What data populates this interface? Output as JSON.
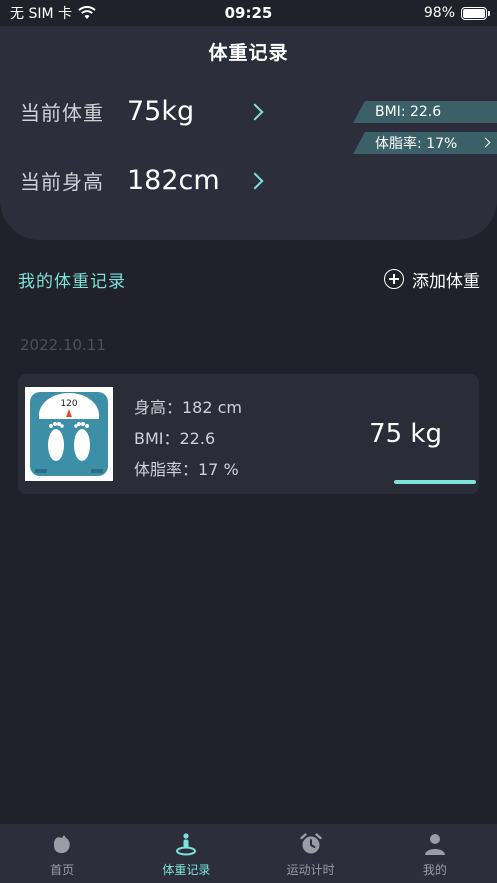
{
  "status_bar": {
    "carrier": "无 SIM 卡",
    "time": "09:25",
    "battery": "98%",
    "battery_level": 0.98
  },
  "header": {
    "title": "体重记录",
    "weight_label": "当前体重",
    "weight_value": "75kg",
    "height_label": "当前身高",
    "height_value": "182cm",
    "bmi_tag": "BMI: 22.6",
    "fat_tag": "体脂率: 17%"
  },
  "records": {
    "section_title": "我的体重记录",
    "add_label": "添加体重",
    "date": "2022.10.11",
    "item": {
      "scale_reading": "120",
      "height_line": "身高：182 cm",
      "bmi_line": "BMI：22.6",
      "fat_line": "体脂率：17 %",
      "weight": "75 kg"
    }
  },
  "tabs": [
    {
      "label": "首页",
      "icon": "home-icon"
    },
    {
      "label": "体重记录",
      "icon": "scale-person-icon",
      "active": true
    },
    {
      "label": "运动计时",
      "icon": "alarm-clock-icon"
    },
    {
      "label": "我的",
      "icon": "user-icon"
    }
  ],
  "colors": {
    "accent": "#7de3d8",
    "background": "#20212b",
    "card": "#2c2e3b",
    "tag": "#3c6068"
  }
}
